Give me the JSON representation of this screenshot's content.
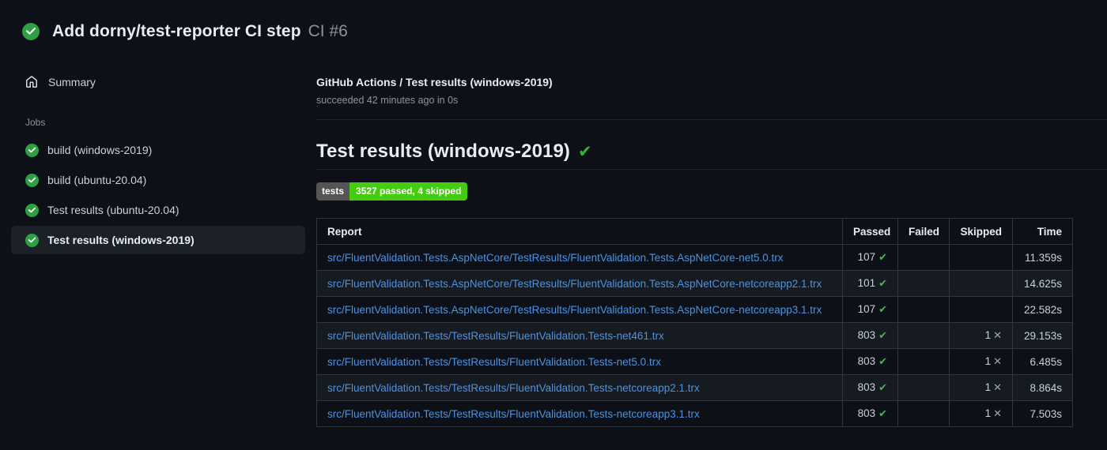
{
  "header": {
    "title": "Add dorny/test-reporter CI step",
    "run_number": "CI #6"
  },
  "sidebar": {
    "summary_label": "Summary",
    "jobs_label": "Jobs",
    "jobs": [
      {
        "label": "build (windows-2019)",
        "selected": false
      },
      {
        "label": "build (ubuntu-20.04)",
        "selected": false
      },
      {
        "label": "Test results (ubuntu-20.04)",
        "selected": false
      },
      {
        "label": "Test results (windows-2019)",
        "selected": true
      }
    ]
  },
  "run_header": {
    "title": "GitHub Actions / Test results (windows-2019)",
    "status_line": "succeeded 42 minutes ago in 0s"
  },
  "main": {
    "heading": "Test results (windows-2019)",
    "badge": {
      "label": "tests",
      "value": "3527 passed, 4 skipped"
    },
    "table": {
      "columns": [
        "Report",
        "Passed",
        "Failed",
        "Skipped",
        "Time"
      ],
      "rows": [
        {
          "report": "src/FluentValidation.Tests.AspNetCore/TestResults/FluentValidation.Tests.AspNetCore-net5.0.trx",
          "passed": "107",
          "failed": "",
          "skipped": "",
          "time": "11.359s"
        },
        {
          "report": "src/FluentValidation.Tests.AspNetCore/TestResults/FluentValidation.Tests.AspNetCore-netcoreapp2.1.trx",
          "passed": "101",
          "failed": "",
          "skipped": "",
          "time": "14.625s"
        },
        {
          "report": "src/FluentValidation.Tests.AspNetCore/TestResults/FluentValidation.Tests.AspNetCore-netcoreapp3.1.trx",
          "passed": "107",
          "failed": "",
          "skipped": "",
          "time": "22.582s"
        },
        {
          "report": "src/FluentValidation.Tests/TestResults/FluentValidation.Tests-net461.trx",
          "passed": "803",
          "failed": "",
          "skipped": "1",
          "time": "29.153s"
        },
        {
          "report": "src/FluentValidation.Tests/TestResults/FluentValidation.Tests-net5.0.trx",
          "passed": "803",
          "failed": "",
          "skipped": "1",
          "time": "6.485s"
        },
        {
          "report": "src/FluentValidation.Tests/TestResults/FluentValidation.Tests-netcoreapp2.1.trx",
          "passed": "803",
          "failed": "",
          "skipped": "1",
          "time": "8.864s"
        },
        {
          "report": "src/FluentValidation.Tests/TestResults/FluentValidation.Tests-netcoreapp3.1.trx",
          "passed": "803",
          "failed": "",
          "skipped": "1",
          "time": "7.503s"
        }
      ]
    }
  },
  "icons": {
    "pass_check_glyph": "✔",
    "skip_x_glyph": "✕",
    "heading_check_glyph": "✔"
  },
  "colors": {
    "page_bg": "#0d1117",
    "success_green": "#2ea043",
    "check_green": "#3fb950",
    "badge_label_bg": "#555555",
    "badge_value_bg": "#44cc11",
    "link_blue": "#4b92e2",
    "muted": "#8b949e",
    "border": "#30363d"
  }
}
